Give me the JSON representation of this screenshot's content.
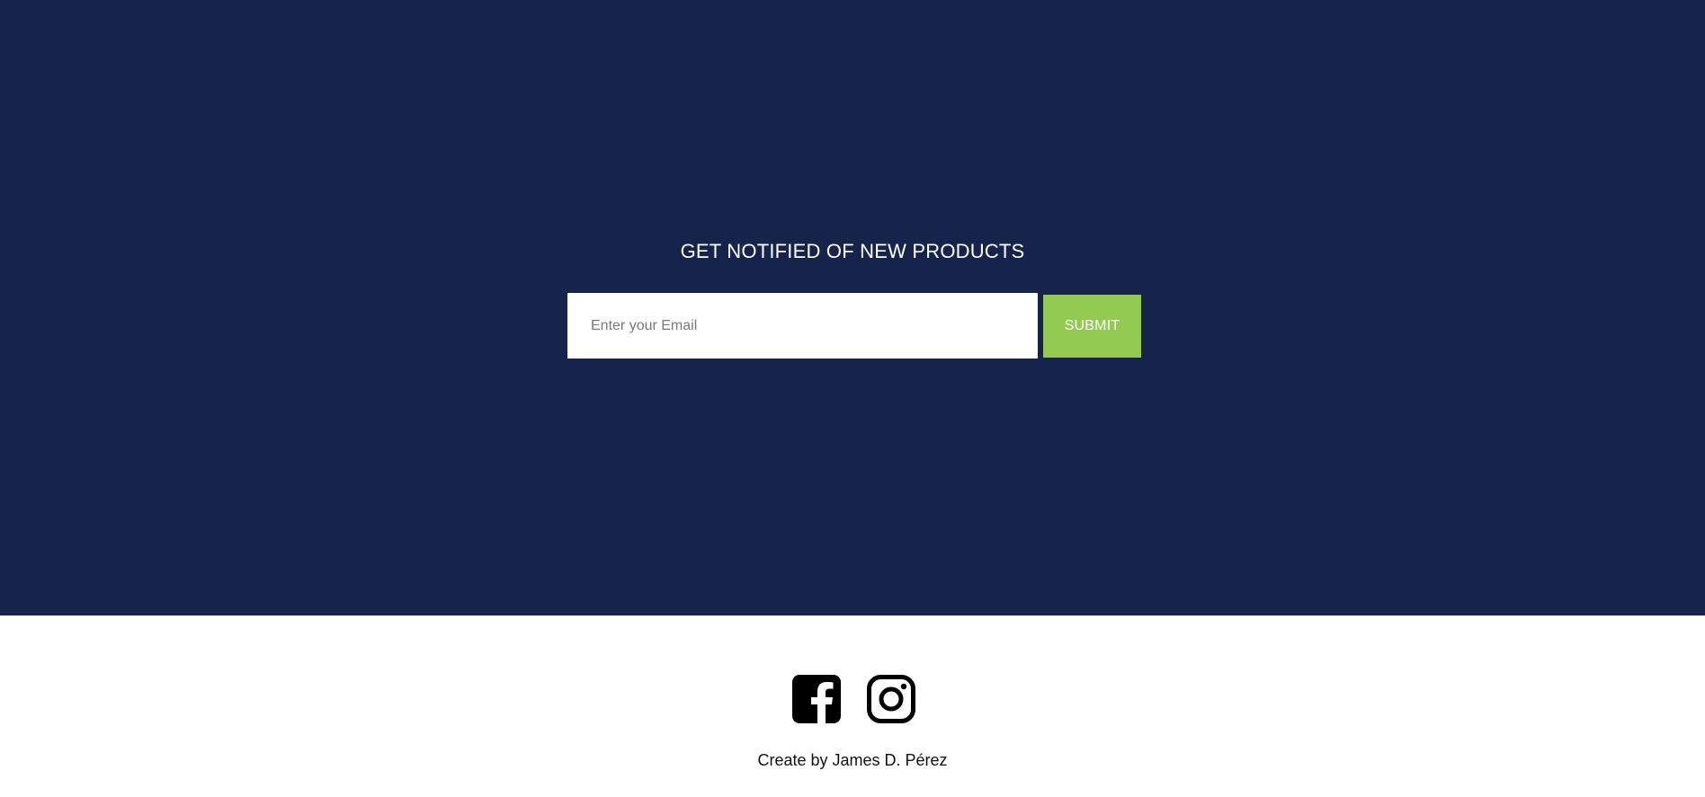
{
  "newsletter": {
    "title": "GET NOTIFIED OF NEW PRODUCTS",
    "email_placeholder": "Enter your Email",
    "email_value": "",
    "submit_label": "SUBMIT"
  },
  "footer": {
    "social_icons": [
      "facebook-icon",
      "instagram-icon"
    ],
    "credit": "Create by James D. Pérez"
  },
  "colors": {
    "newsletter_background": "#16244b",
    "submit_background": "#93cb52",
    "footer_background": "#ffffff",
    "icon_color": "#000000"
  }
}
